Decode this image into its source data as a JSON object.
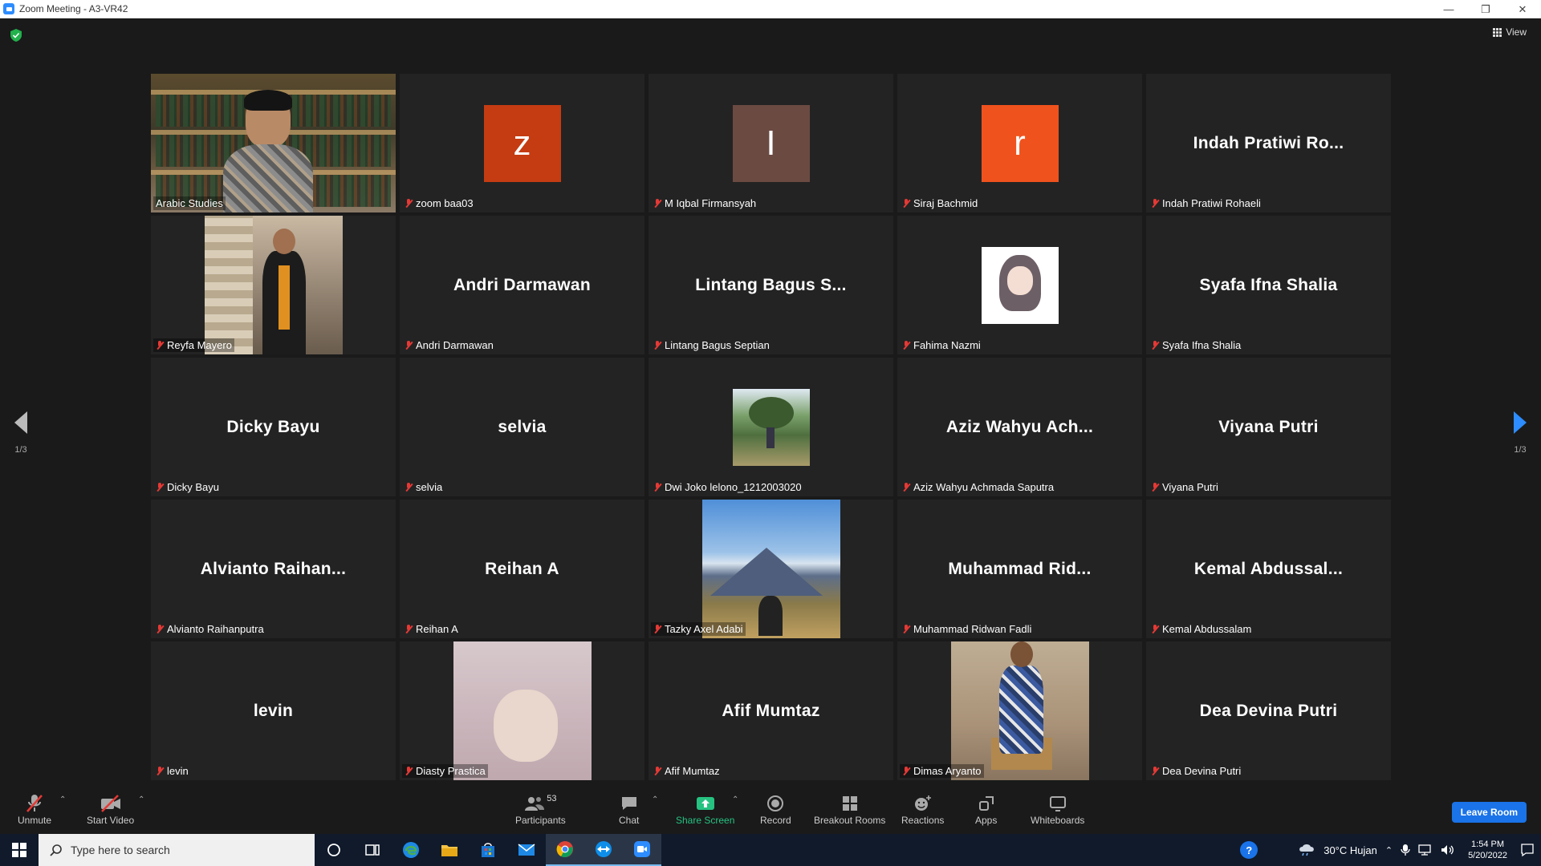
{
  "window": {
    "title": "Zoom Meeting - A3-VR42",
    "minimize": "—",
    "restore": "❐",
    "close": "✕"
  },
  "top": {
    "view_label": "View"
  },
  "pagination": {
    "left_page": "1/3",
    "right_page": "1/3"
  },
  "tiles": [
    {
      "name": "Arabic Studies",
      "kind": "video-main",
      "muted": false,
      "active": true
    },
    {
      "name": "zoom baa03",
      "kind": "letter",
      "letter": "z",
      "color": "#c53b12",
      "muted": true
    },
    {
      "name": "M Iqbal Firmansyah",
      "kind": "letter",
      "letter": "I",
      "color": "#6b4a42",
      "muted": true
    },
    {
      "name": "Siraj Bachmid",
      "kind": "letter",
      "letter": "r",
      "color": "#f0521d",
      "muted": true
    },
    {
      "name": "Indah Pratiwi Rohaeli",
      "display": "Indah Pratiwi Ro...",
      "kind": "name",
      "muted": true
    },
    {
      "name": "Reyfa Mayero",
      "kind": "video-reyfa",
      "muted": true
    },
    {
      "name": "Andri Darmawan",
      "display": "Andri Darmawan",
      "kind": "name",
      "muted": true
    },
    {
      "name": "Lintang Bagus Septian",
      "display": "Lintang Bagus S...",
      "kind": "name",
      "muted": true
    },
    {
      "name": "Fahima Nazmi",
      "kind": "pic-fahima",
      "muted": true
    },
    {
      "name": "Syafa Ifna Shalia",
      "display": "Syafa Ifna Shalia",
      "kind": "name",
      "muted": true
    },
    {
      "name": "Dicky Bayu",
      "display": "Dicky Bayu",
      "kind": "name",
      "muted": true
    },
    {
      "name": "selvia",
      "display": "selvia",
      "kind": "name",
      "muted": true
    },
    {
      "name": "Dwi Joko lelono_1212003020",
      "kind": "pic-dwi",
      "muted": true
    },
    {
      "name": "Aziz Wahyu Achmada Saputra",
      "display": "Aziz Wahyu Ach...",
      "kind": "name",
      "muted": true
    },
    {
      "name": "Viyana Putri",
      "display": "Viyana Putri",
      "kind": "name",
      "muted": true
    },
    {
      "name": "Alvianto Raihanputra",
      "display": "Alvianto Raihan...",
      "kind": "name",
      "muted": true
    },
    {
      "name": "Reihan A",
      "display": "Reihan A",
      "kind": "name",
      "muted": true
    },
    {
      "name": "Tazky Axel Adabi",
      "kind": "video-mountain",
      "muted": true
    },
    {
      "name": "Muhammad Ridwan Fadli",
      "display": "Muhammad Rid...",
      "kind": "name",
      "muted": true
    },
    {
      "name": "Kemal Abdussalam",
      "display": "Kemal Abdussal...",
      "kind": "name",
      "muted": true
    },
    {
      "name": "levin",
      "display": "levin",
      "kind": "name",
      "muted": true
    },
    {
      "name": "Diasty Prastica",
      "kind": "video-hijab",
      "muted": true
    },
    {
      "name": "Afif Mumtaz",
      "display": "Afif Mumtaz",
      "kind": "name",
      "muted": true
    },
    {
      "name": "Dimas Aryanto",
      "kind": "video-dimas",
      "muted": true
    },
    {
      "name": "Dea Devina Putri",
      "display": "Dea Devina Putri",
      "kind": "name",
      "muted": true
    }
  ],
  "toolbar": {
    "unmute": "Unmute",
    "start_video": "Start Video",
    "participants": "Participants",
    "participants_count": "53",
    "chat": "Chat",
    "share_screen": "Share Screen",
    "record": "Record",
    "breakout_rooms": "Breakout Rooms",
    "reactions": "Reactions",
    "apps": "Apps",
    "whiteboards": "Whiteboards",
    "leave_room": "Leave Room"
  },
  "taskbar": {
    "search_placeholder": "Type here to search",
    "weather": "30°C  Hujan",
    "time": "1:54 PM",
    "date": "5/20/2022"
  },
  "colors": {
    "active_border": "#d7e53b",
    "share_green": "#26c281",
    "leave_blue": "#1a73e8",
    "muted_red": "#e53935"
  }
}
